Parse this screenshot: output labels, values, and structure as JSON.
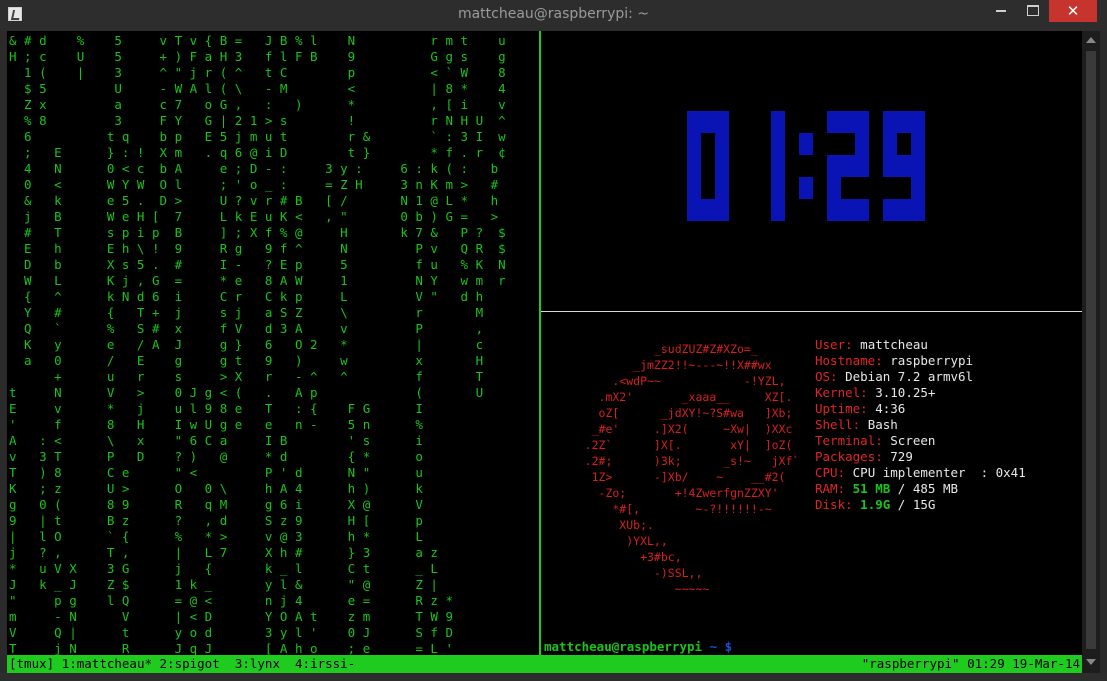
{
  "window": {
    "title": "mattcheau@raspberrypi: ~",
    "minimize_icon": "minimize-icon",
    "maximize_icon": "maximize-icon",
    "close_icon": "close-icon",
    "close_symbol": "✕"
  },
  "colors": {
    "matrix_green": "#19c419",
    "status_green": "#1fcb1f",
    "clock_blue": "#0a14b4",
    "info_red": "#e02525",
    "prompt_blue": "#1f4fd6"
  },
  "matrix_rain": {
    "lines": [
      "& # d    %    5     v T v { B =   J B % l    N          r m t    u",
      "H ; c    U    5     + ) F a H 3   f l F B    9          G g s    g",
      "  1 (    |    3     ^ \" j r ( ^   t C        p          < ` W    8",
      "  $ 5         U     - W A l ( \\   - M        <          | 8 *    4",
      "  Z x         a     c 7   o G ,   :   )      *          , [ i    v",
      "  % 8         3     F Y   G | 2 1 > s        !          r N H U  ^",
      "  6          t q    b p   E 5 j m u t        r &        ` : 3 I  w",
      "  ;   E      } : !  X m   . q 6 @ i D        t }        * f . r  ¢",
      "  4   N      0 < c  b A     e ; D - :     3 y :     6 : k ( :   b",
      "  0   <      W Y W  O l     ; ' o _ :     = Z H     3 n K m >   #",
      "  &   k      e 5 .  D >     U ? v r # B   [ /       N 1 @ L *   h",
      "  j   B      W e H [  7     L k E u K <   , \"       0 b ) G =   >",
      "  #   T      s p i p  B     ] ; X f % @     H       k 7 &   P ?  $",
      "  E   h      E h \\ !  9     R g   9 f ^     N         P v   Q R  $",
      "  D   b      X s 5 .  #     I -   ? E p     5         f u   % K  N",
      "  W   L      K j , G  =     * e   8 A W     1         N Y   w m  r",
      "  {   ^      k N d 6  i     C r   C k p     L         V \"   d h",
      "  Y   #      {   T +  j     s j   a S Z     \\         r       M",
      "  Q   `      %   S #  x     f V   d 3 A     v         P       ,",
      "  K   y      e   / A  J     g }   6   O 2   *         |       c",
      "  a   0      /   E    g     g t   9   )     w         x       H",
      "      +      u   r    s     > X   r   - ^   ^         f       T",
      "t     N      V   >    0 J g < (   .   A p             (       U",
      "E     v      *   j    u l 9 8 e   T   : {    F G      I",
      "'     f      8   H    I w U g e   e   n -    5 n      %",
      "A   : <      \\   x    \" 6 C a     I B        ' s      i",
      "v   3 T      P   D    ? )   @     * d        { *      o",
      "T   ) 8      C e      \" <         P ' d      N \"      u",
      "K   ; z      U >      O   0 \\     h A 4      h )      k",
      "g   0 (      8 9      R   q M     g 6 i      X @      V",
      "9   | t      B z      ?   , d     S z 9      H [      p",
      "|   l O      ` {      %   * >     v @ 3      h *      L",
      "j   ? ,      T ,      |   L 7     X h #      } 3      a z",
      "*   u V X    3 G      j   {       k _ l      C t      _ L",
      "J   k _ J    Z $      1 k _       y l &      \" @      Z |",
      "\"     p g    l Q      = @ <       n j 4      e =      R z *",
      "m     - N      V      | < D       Y O A t    z m      T W 9",
      "V     Q |      t      y o d       3 y l '    0 J      S f D",
      "T     j N      R      J q J       [ A h o    ; e      = L '"
    ]
  },
  "clock": {
    "time": "01:29"
  },
  "system_info": {
    "logo_lines": [
      "              _sudZUZ#Z#XZo=_",
      "           _jmZZ2!!~---~!!X##wx",
      "        .<wdP~~            -!YZL,",
      "      .mX2'       _xaaa__     XZ[.",
      "      oZ[      _jdXY!~?S#wa   ]Xb;",
      "     _#e'     .]X2(     ~Xw|  )XXc",
      "    .2Z`      ]X[.       xY|  ]oZ(",
      "    .2#;      )3k;      _s!~   jXf`",
      "     1Z>      -]Xb/    ~    __#2(",
      "      -Zo;       +!4ZwerfgnZZXY'",
      "        *#[,        ~-?!!!!!!-~",
      "         XUb;.",
      "          )YXL,,",
      "            +3#bc,",
      "              -)SSL,,",
      "                 ~~~~~"
    ],
    "rows": [
      {
        "key": "User:",
        "value": "mattcheau"
      },
      {
        "key": "Hostname:",
        "value": "raspberrypi"
      },
      {
        "key": "OS:",
        "value": "Debian 7.2 armv6l"
      },
      {
        "key": "Kernel:",
        "value": "3.10.25+"
      },
      {
        "key": "Uptime:",
        "value": "4:36"
      },
      {
        "key": "Shell:",
        "value": "Bash"
      },
      {
        "key": "Terminal:",
        "value": "Screen"
      },
      {
        "key": "Packages:",
        "value": "729"
      },
      {
        "key": "CPU:",
        "value": "CPU implementer  : 0x41"
      }
    ],
    "ram": {
      "key": "RAM:",
      "used": "51 MB",
      "sep": " / ",
      "total": "485 MB"
    },
    "disk": {
      "key": "Disk:",
      "used": "1.9G",
      "sep": " / ",
      "total": "15G"
    }
  },
  "prompt": {
    "user_host": "mattcheau@raspberrypi",
    "sep": " ~ $"
  },
  "tmux": {
    "session": "[tmux]",
    "windows": [
      {
        "label": "1:mattcheau*"
      },
      {
        "label": "2:spigot"
      },
      {
        "label": "3:lynx"
      },
      {
        "label": "4:irssi-"
      }
    ],
    "host": "\"raspberrypi\"",
    "time": "01:29",
    "date": "19-Mar-14"
  }
}
